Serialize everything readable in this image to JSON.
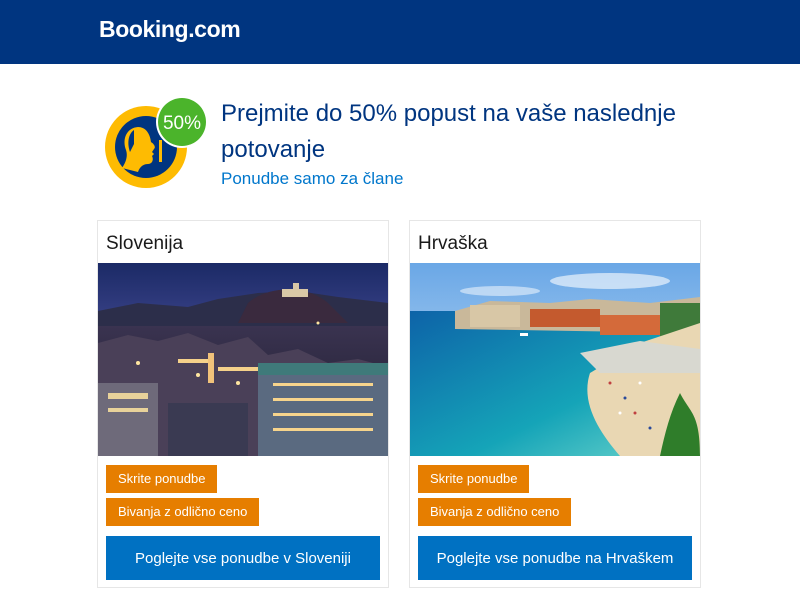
{
  "header": {
    "logo": "Booking.com",
    "background_color": "#003580"
  },
  "promo": {
    "badge_percent": "50%",
    "badge_icon": "secret-deal-shush-icon",
    "title": "Prejmite do 50% popust na vaše naslednje potovanje",
    "subtitle": "Ponudbe samo za člane"
  },
  "destinations": [
    {
      "name": "Slovenija",
      "image": "ljubljana-night-photo",
      "tags": [
        "Skrite ponudbe",
        "Bivanja z odlično ceno"
      ],
      "cta": "Poglejte vse ponudbe v Sloveniji"
    },
    {
      "name": "Hrvaška",
      "image": "dubrovnik-beach-photo",
      "tags": [
        "Skrite ponudbe",
        "Bivanja z odlično ceno"
      ],
      "cta": "Poglejte vse ponudbe na Hrvaškem"
    }
  ],
  "colors": {
    "brand": "#003580",
    "accent": "#0071c2",
    "tag": "#e67e00",
    "badge_green": "#4bb42b",
    "badge_yellow": "#febb02"
  }
}
